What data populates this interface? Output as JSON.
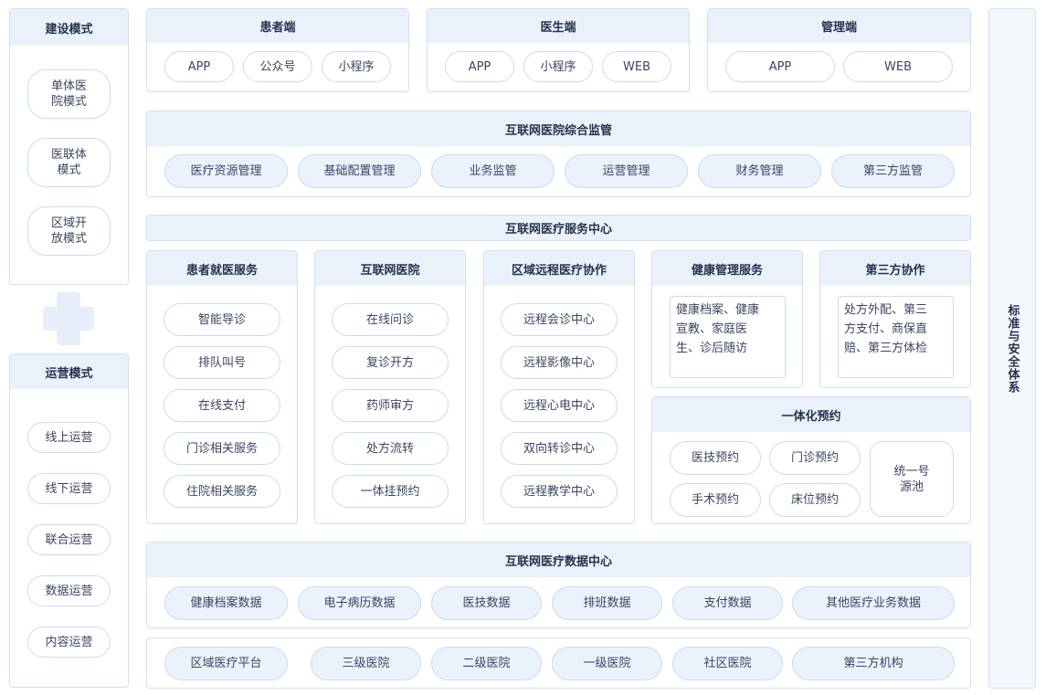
{
  "build_mode": {
    "title": "建设模式",
    "items": [
      {
        "lines": [
          "单体医",
          "院模式"
        ]
      },
      {
        "lines": [
          "医联体",
          "模式"
        ]
      },
      {
        "lines": [
          "区域开",
          "放模式"
        ]
      }
    ]
  },
  "ops_mode": {
    "title": "运营模式",
    "items": [
      "线上运营",
      "线下运营",
      "联合运营",
      "数据运营",
      "内容运营"
    ]
  },
  "patient_end": {
    "title": "患者端",
    "items": [
      "APP",
      "公众号",
      "小程序"
    ]
  },
  "doctor_end": {
    "title": "医生端",
    "items": [
      "APP",
      "小程序",
      "WEB"
    ]
  },
  "admin_end": {
    "title": "管理端",
    "items": [
      "APP",
      "WEB"
    ]
  },
  "supervision": {
    "title": "互联网医院综合监管",
    "items": [
      "医疗资源管理",
      "基础配置管理",
      "业务监管",
      "运营管理",
      "财务管理",
      "第三方监管"
    ]
  },
  "service_center": {
    "title": "互联网医疗服务中心"
  },
  "patient_services": {
    "title": "患者就医服务",
    "items": [
      "智能导诊",
      "排队叫号",
      "在线支付",
      "门诊相关服务",
      "住院相关服务"
    ]
  },
  "internet_hospital": {
    "title": "互联网医院",
    "items": [
      "在线问诊",
      "复诊开方",
      "药师审方",
      "处方流转",
      "一体挂预约"
    ]
  },
  "regional_remote": {
    "title": "区域远程医疗协作",
    "items": [
      "远程会诊中心",
      "远程影像中心",
      "远程心电中心",
      "双向转诊中心",
      "远程教学中心"
    ]
  },
  "health_mgmt": {
    "title": "健康管理服务",
    "lines": [
      "健康档案、健康",
      "宣教、家庭医",
      "生、诊后随访"
    ]
  },
  "third_party": {
    "title": "第三方协作",
    "lines": [
      "处方外配、第三",
      "方支付、商保直",
      "赔、第三方体检"
    ]
  },
  "appointment": {
    "title": "一体化预约",
    "items": [
      "医技预约",
      "门诊预约",
      "手术预约",
      "床位预约"
    ],
    "pool_lines": [
      "统一号",
      "源池"
    ]
  },
  "data_center": {
    "title": "互联网医疗数据中心",
    "items": [
      "健康档案数据",
      "电子病历数据",
      "医技数据",
      "排班数据",
      "支付数据",
      "其他医疗业务数据"
    ]
  },
  "institutions": {
    "items": [
      "区域医疗平台",
      "三级医院",
      "二级医院",
      "一级医院",
      "社区医院",
      "第三方机构"
    ]
  },
  "standards": {
    "title": "标准与安全体系"
  }
}
